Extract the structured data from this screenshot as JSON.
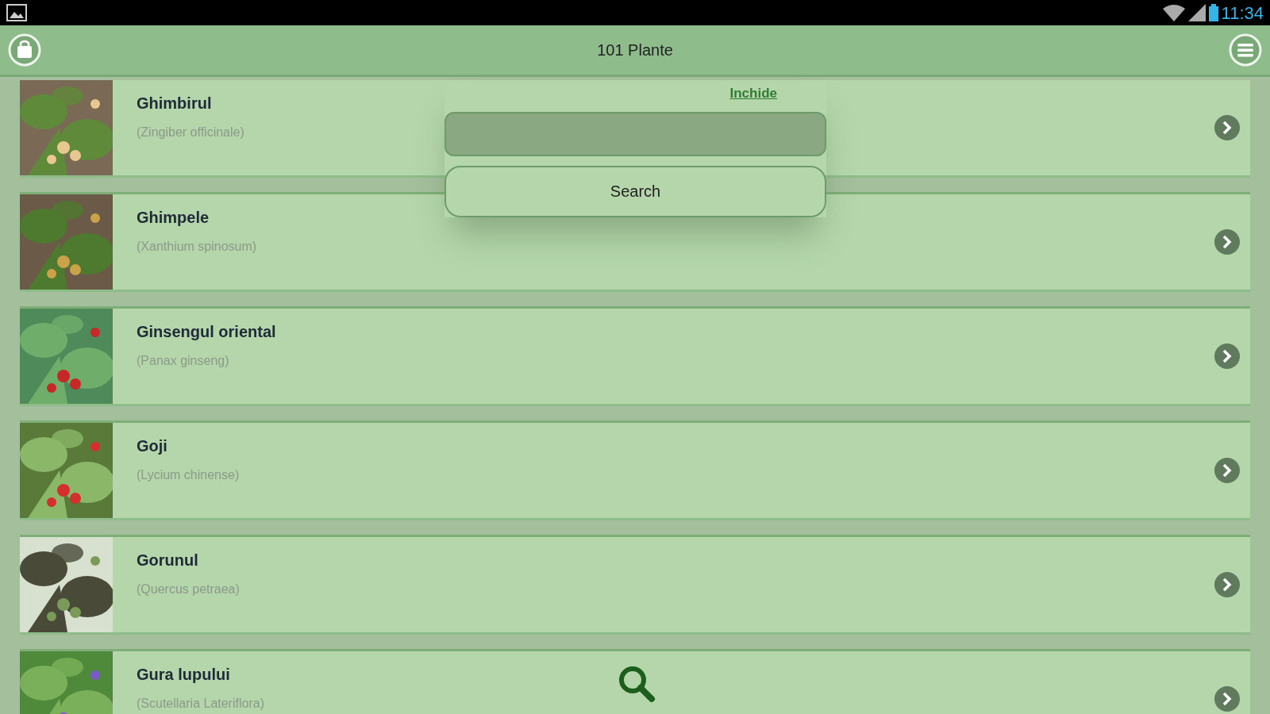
{
  "status_bar": {
    "time": "11:34"
  },
  "header": {
    "title": "101 Plante"
  },
  "plants": [
    {
      "name": "Ghimbirul",
      "latin": "(Zingiber officinale)"
    },
    {
      "name": "Ghimpele",
      "latin": "(Xanthium spinosum)"
    },
    {
      "name": "Ginsengul oriental",
      "latin": "(Panax ginseng)"
    },
    {
      "name": "Goji",
      "latin": "(Lycium chinense)"
    },
    {
      "name": "Gorunul",
      "latin": "(Quercus petraea)"
    },
    {
      "name": "Gura lupului",
      "latin": "(Scutellaria Lateriflora)"
    }
  ],
  "search_popup": {
    "close_link": "Inchide",
    "button": "Search"
  }
}
